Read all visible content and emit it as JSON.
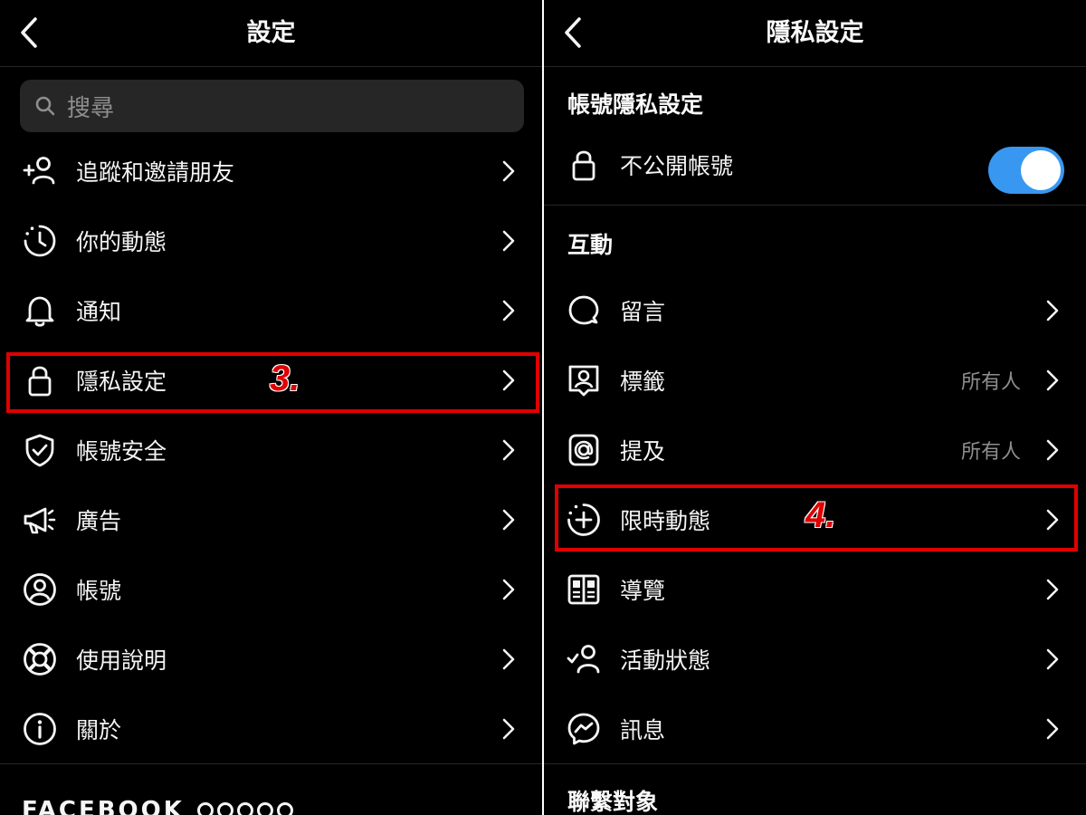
{
  "left": {
    "title": "設定",
    "search_placeholder": "搜尋",
    "items": [
      {
        "label": "追蹤和邀請朋友",
        "icon": "add-person-icon"
      },
      {
        "label": "你的動態",
        "icon": "activity-clock-icon"
      },
      {
        "label": "通知",
        "icon": "bell-icon"
      },
      {
        "label": "隱私設定",
        "icon": "lock-icon"
      },
      {
        "label": "帳號安全",
        "icon": "shield-check-icon"
      },
      {
        "label": "廣告",
        "icon": "megaphone-icon"
      },
      {
        "label": "帳號",
        "icon": "account-circle-icon"
      },
      {
        "label": "使用說明",
        "icon": "lifebuoy-icon"
      },
      {
        "label": "關於",
        "icon": "info-icon"
      }
    ],
    "step_label": "3.",
    "footer_brand": "FACEBOOK"
  },
  "right": {
    "title": "隱私設定",
    "section_account": "帳號隱私設定",
    "private_account": {
      "label": "不公開帳號",
      "enabled": true
    },
    "section_interactions": "互動",
    "items": [
      {
        "label": "留言",
        "icon": "comment-icon",
        "value": ""
      },
      {
        "label": "標籤",
        "icon": "tag-person-icon",
        "value": "所有人"
      },
      {
        "label": "提及",
        "icon": "at-icon",
        "value": "所有人"
      },
      {
        "label": "限時動態",
        "icon": "story-add-icon",
        "value": ""
      },
      {
        "label": "導覽",
        "icon": "guide-icon",
        "value": ""
      },
      {
        "label": "活動狀態",
        "icon": "activity-status-icon",
        "value": ""
      },
      {
        "label": "訊息",
        "icon": "messenger-icon",
        "value": ""
      }
    ],
    "step_label": "4.",
    "section_connections": "聯繫對象"
  },
  "colors": {
    "background": "#000000",
    "toggle_on": "#3897f0",
    "highlight": "#e00000",
    "secondary_text": "#8e8e8e"
  }
}
